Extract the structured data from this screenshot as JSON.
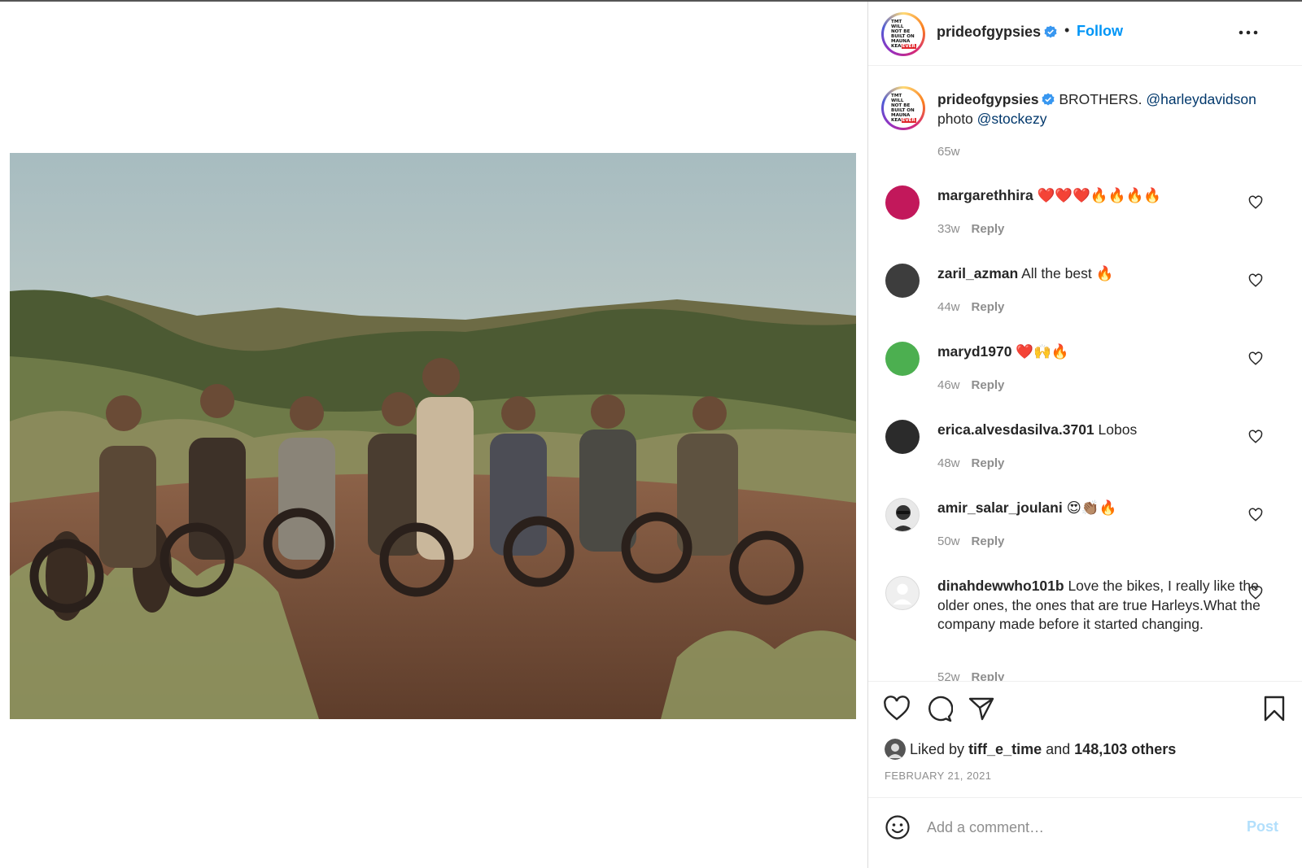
{
  "post": {
    "username": "prideofgypsies",
    "avatar_text": [
      "TMT WILL",
      "NOT BE",
      "BUILT ON",
      "MAUNA",
      "KEA"
    ],
    "avatar_badge": "EVER",
    "follow_label": "Follow",
    "separator": "•",
    "more_icon": "more-horizontal-icon"
  },
  "caption": {
    "username": "prideofgypsies",
    "text_before": "BROTHERS.",
    "mention1": "@harleydavidson",
    "text_mid": "photo",
    "mention2": "@stockezy",
    "time": "65w"
  },
  "comments": [
    {
      "username": "margarethhira",
      "text": "❤️❤️❤️🔥🔥🔥🔥",
      "time": "33w",
      "reply": "Reply",
      "avatar_color": "#c2185b"
    },
    {
      "username": "zaril_azman",
      "text": "All the best 🔥",
      "time": "44w",
      "reply": "Reply",
      "avatar_color": "#3d3d3d"
    },
    {
      "username": "maryd1970",
      "text": "❤️🙌🔥",
      "time": "46w",
      "reply": "Reply",
      "avatar_color": "#4caf50"
    },
    {
      "username": "erica.alvesdasilva.3701",
      "text": "Lobos",
      "time": "48w",
      "reply": "Reply",
      "avatar_color": "#2b2b2b"
    },
    {
      "username": "amir_salar_joulani",
      "text": "😍👏🏽🔥",
      "time": "50w",
      "reply": "Reply",
      "avatar_color": "#e8e8e8"
    },
    {
      "username": "dinahdewwho101b",
      "text": "Love the bikes, I really like the older ones, the ones that are true Harleys.What the company made before it started changing.",
      "time": "52w",
      "reply": "Reply",
      "avatar_color": "#efefef"
    }
  ],
  "actions": {
    "like_icon": "heart-icon",
    "comment_icon": "comment-icon",
    "share_icon": "share-icon",
    "save_icon": "bookmark-icon"
  },
  "likes": {
    "prefix": "Liked by",
    "user": "tiff_e_time",
    "middle": "and",
    "others": "148,103 others"
  },
  "date": "FEBRUARY 21, 2021",
  "composer": {
    "placeholder": "Add a comment…",
    "post_label": "Post",
    "emoji_icon": "emoji-icon"
  },
  "colors": {
    "accent_blue": "#0095f6",
    "mention_blue": "#00376b",
    "muted": "#8e8e8e",
    "post_disabled": "#b2dffc"
  }
}
